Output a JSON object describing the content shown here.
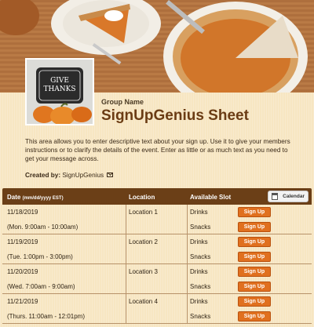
{
  "header": {
    "logo_text": [
      "GIVE",
      "THANKS"
    ]
  },
  "sheet": {
    "group_name": "Group Name",
    "title": "SignUpGenius Sheet",
    "description": "This area allows you to enter descriptive text about your sign up. Use it to give your members instructions or to clarify the details of the event. Enter as little or as much text as you need to get your message across.",
    "created_by_label": "Created by:",
    "created_by_name": "SignUpGenius"
  },
  "table": {
    "headers": {
      "date": "Date",
      "date_format": "(mm/dd/yyyy EST)",
      "location": "Location",
      "slot": "Available Slot"
    },
    "calendar_button": "Calendar",
    "rows": [
      {
        "date": "11/18/2019",
        "time": "(Mon. 9:00am - 10:00am)",
        "location": "Location 1",
        "slots": [
          "Drinks",
          "Snacks"
        ]
      },
      {
        "date": "11/19/2019",
        "time": "(Tue. 1:00pm - 3:00pm)",
        "location": "Location 2",
        "slots": [
          "Drinks",
          "Snacks"
        ]
      },
      {
        "date": "11/20/2019",
        "time": "(Wed. 7:00am - 9:00am)",
        "location": "Location 3",
        "slots": [
          "Drinks",
          "Snacks"
        ]
      },
      {
        "date": "11/21/2019",
        "time": "(Thurs. 11:00am - 12:01pm)",
        "location": "Location 4",
        "slots": [
          "Drinks",
          "Snacks"
        ]
      }
    ],
    "signup_label": "Sign Up"
  },
  "colors": {
    "header_bar": "#6b3f17",
    "button": "#e0701f",
    "title": "#6b3c14",
    "background": "#f7e6c2"
  }
}
